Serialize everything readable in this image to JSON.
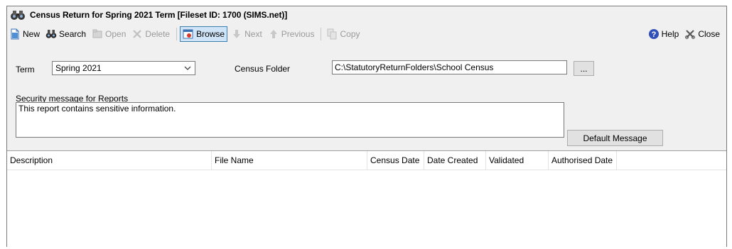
{
  "window": {
    "title": "Census Return for Spring 2021 Term [Fileset ID:  1700 (SIMS.net)]"
  },
  "toolbar": {
    "new": "New",
    "search": "Search",
    "open": "Open",
    "delete": "Delete",
    "browse": "Browse",
    "next": "Next",
    "previous": "Previous",
    "copy": "Copy",
    "help": "Help",
    "close": "Close"
  },
  "form": {
    "term_label": "Term",
    "term_value": "Spring 2021",
    "census_folder_label": "Census Folder",
    "census_folder_value": "C:\\StatutoryReturnFolders\\School Census",
    "browse_folder_button": "...",
    "security_label": "Security message for Reports",
    "security_message": "This report contains sensitive information.",
    "default_message_button": "Default Message"
  },
  "grid": {
    "columns": [
      "Description",
      "File Name",
      "Census Date",
      "Date Created",
      "Validated",
      "Authorised Date"
    ],
    "rows": []
  },
  "icons": {
    "title": "binoculars-icon",
    "new": "new-document-icon",
    "search": "binoculars-icon",
    "open": "open-icon",
    "delete": "delete-icon",
    "browse": "browse-icon",
    "next": "down-arrow-icon",
    "previous": "up-arrow-icon",
    "copy": "copy-icon",
    "help": "help-icon",
    "close": "close-icon"
  },
  "colors": {
    "window_bg": "#f0f0f0",
    "browse_active_bg": "#cfe4f7",
    "browse_active_border": "#3c7fb1",
    "disabled_text": "#9a9a9a"
  }
}
